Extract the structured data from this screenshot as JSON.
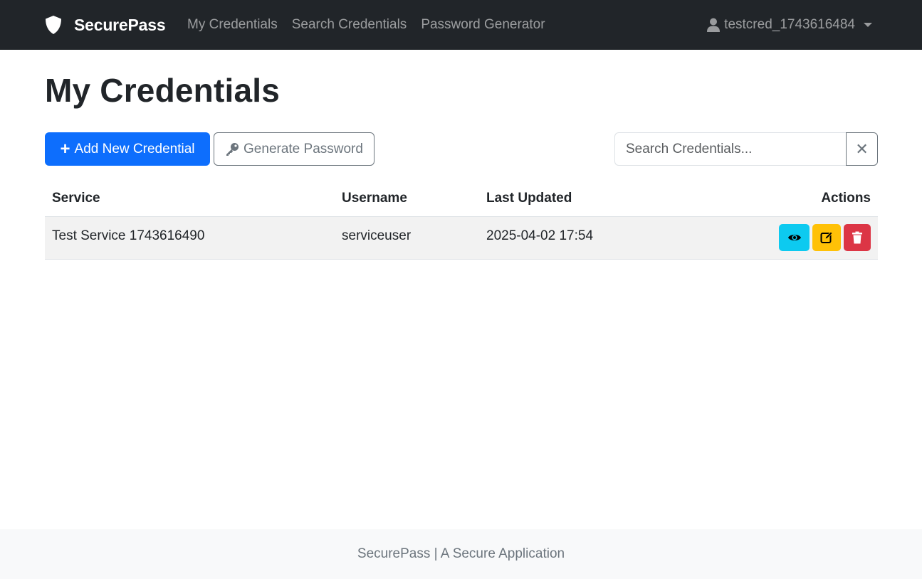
{
  "navbar": {
    "brand": "SecurePass",
    "brand_icon": "shield-icon",
    "links": [
      "My Credentials",
      "Search Credentials",
      "Password Generator"
    ],
    "user": "testcred_1743616484"
  },
  "page": {
    "title": "My Credentials"
  },
  "toolbar": {
    "add_label": "Add New Credential",
    "generate_label": "Generate Password",
    "search_placeholder": "Search Credentials..."
  },
  "table": {
    "headers": [
      "Service",
      "Username",
      "Last Updated",
      "Actions"
    ],
    "rows": [
      {
        "service": "Test Service 1743616490",
        "username": "serviceuser",
        "updated": "2025-04-02 17:54"
      }
    ]
  },
  "footer": {
    "text": "SecurePass | A Secure Application"
  },
  "colors": {
    "navbar": "#212529",
    "primary": "#0d6efd",
    "info": "#0dcaf0",
    "warning": "#ffc107",
    "danger": "#dc3545"
  }
}
